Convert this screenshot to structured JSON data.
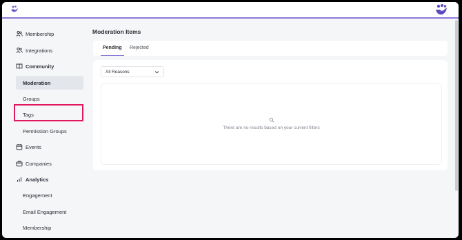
{
  "colors": {
    "accent": "#8c79d8",
    "highlight": "#e0195c"
  },
  "sidebar": {
    "items": [
      {
        "label": "Membership",
        "icon": "users-icon"
      },
      {
        "label": "Integrations",
        "icon": "users-icon"
      },
      {
        "label": "Community",
        "icon": "book-icon"
      },
      {
        "label": "Moderation"
      },
      {
        "label": "Groups"
      },
      {
        "label": "Tags"
      },
      {
        "label": "Permission Groups"
      },
      {
        "label": "Events",
        "icon": "calendar-icon"
      },
      {
        "label": "Companies",
        "icon": "briefcase-icon"
      },
      {
        "label": "Analytics",
        "icon": "bar-chart-icon"
      },
      {
        "label": "Engagement"
      },
      {
        "label": "Email Engagement"
      },
      {
        "label": "Membership"
      }
    ]
  },
  "main": {
    "title": "Moderation Items",
    "tabs": [
      {
        "label": "Pending"
      },
      {
        "label": "Rejected"
      }
    ],
    "filter": {
      "selected": "All Reasons"
    },
    "empty_message": "There are no results based on your current filters"
  }
}
